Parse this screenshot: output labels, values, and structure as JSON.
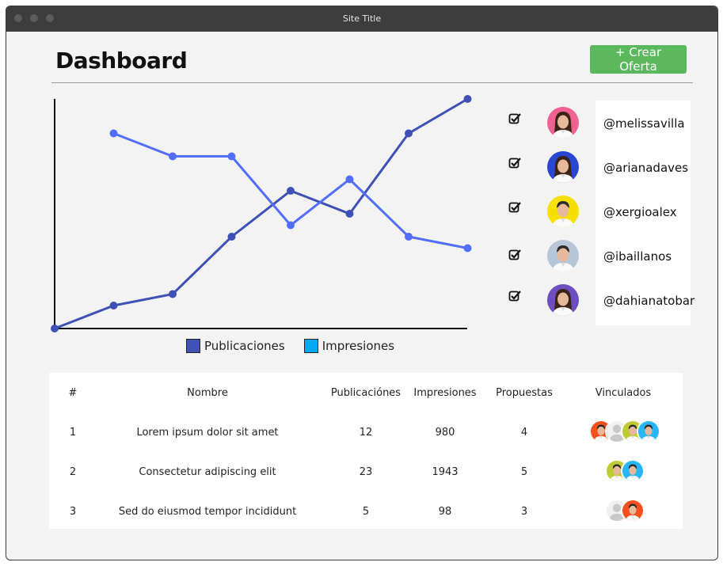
{
  "window": {
    "title": "Site Title"
  },
  "header": {
    "title": "Dashboard",
    "create_button": "+ Crear Oferta"
  },
  "chart_data": {
    "type": "line",
    "x": [
      0,
      1,
      2,
      3,
      4,
      5,
      6,
      7
    ],
    "series": [
      {
        "name": "Publicaciones",
        "color": "#3f51b5",
        "values": [
          0,
          1,
          1.5,
          4,
          6,
          5,
          8.5,
          10
        ]
      },
      {
        "name": "Impresiones",
        "color": "#536dfe",
        "values": [
          null,
          8.5,
          7.5,
          7.5,
          4.5,
          6.5,
          4,
          3.5
        ]
      }
    ],
    "ylim": [
      0,
      10
    ],
    "legend": [
      {
        "label": "Publicaciones",
        "color": "#3f51b5"
      },
      {
        "label": "Impresiones",
        "color": "#03a9f4"
      }
    ]
  },
  "users": [
    {
      "handle": "@melissavilla",
      "checked": true,
      "avatar_bg": "#f06292",
      "icon": "avatar-woman-icon"
    },
    {
      "handle": "@arianadaves",
      "checked": true,
      "avatar_bg": "#2a47d4",
      "icon": "avatar-woman-icon"
    },
    {
      "handle": "@xergioalex",
      "checked": true,
      "avatar_bg": "#f5e000",
      "icon": "avatar-man-icon"
    },
    {
      "handle": "@ibaillanos",
      "checked": true,
      "avatar_bg": "#b7c6d6",
      "icon": "avatar-man-icon"
    },
    {
      "handle": "@dahianatobar",
      "checked": true,
      "avatar_bg": "#6f4fbf",
      "icon": "avatar-woman-icon"
    }
  ],
  "table": {
    "headers": [
      "#",
      "Nombre",
      "Publicaciónes",
      "Impresiones",
      "Propuestas",
      "Vinculados"
    ],
    "rows": [
      {
        "n": "1",
        "nombre": "Lorem ipsum dolor sit amet",
        "publicaciones": "12",
        "impresiones": "980",
        "propuestas": "4",
        "vinculados": [
          "#f4511e",
          "#e0e0e0",
          "#c0ca33",
          "#29b6f6"
        ]
      },
      {
        "n": "2",
        "nombre": "Consectetur adipiscing elit",
        "publicaciones": "23",
        "impresiones": "1943",
        "propuestas": "5",
        "vinculados": [
          "#c0ca33",
          "#29b6f6"
        ]
      },
      {
        "n": "3",
        "nombre": "Sed do eiusmod tempor incididunt",
        "publicaciones": "5",
        "impresiones": "98",
        "propuestas": "3",
        "vinculados": [
          "#e0e0e0",
          "#f4511e"
        ]
      }
    ]
  }
}
